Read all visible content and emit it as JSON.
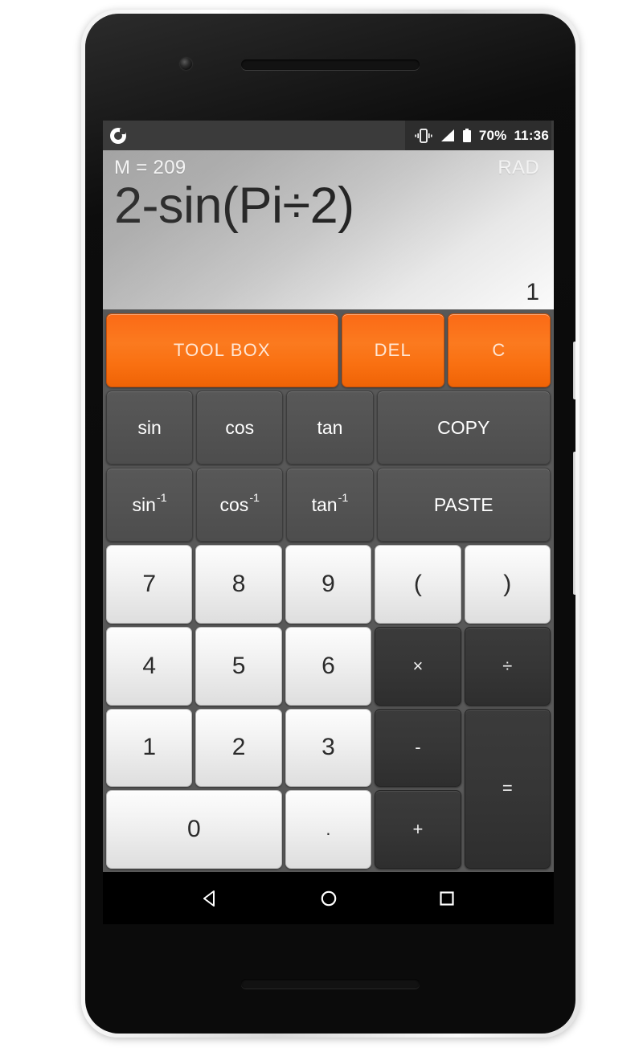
{
  "device": {
    "name": "android-phone",
    "camera_icon": "front-camera",
    "earpiece_icon": "earpiece-speaker",
    "bottom_speaker_icon": "bottom-speaker",
    "power_button": "power-button",
    "volume_button": "volume-rocker"
  },
  "status_bar": {
    "notification_icon": "app-notification-icon",
    "vibrate_icon": "vibrate-icon",
    "signal_icon": "signal-bars-icon",
    "battery_icon": "battery-icon",
    "battery_percent": "70%",
    "clock": "11:36",
    "background_color": "#3b3b3b"
  },
  "display": {
    "memory_label": "M = 209",
    "angle_mode": "RAD",
    "expression": "2-sin(Pi÷2)",
    "result": "1"
  },
  "keypad": {
    "accent_color": "#fb7a1f",
    "row_orange": [
      {
        "label": "TOOL BOX",
        "name": "tool-box-button",
        "span": "f3"
      },
      {
        "label": "DEL",
        "name": "del-button",
        "span": "f13"
      },
      {
        "label": "C",
        "name": "clear-button",
        "span": "f13"
      }
    ],
    "row_trig": [
      {
        "label": "sin",
        "name": "sin-button",
        "span": "f1"
      },
      {
        "label": "cos",
        "name": "cos-button",
        "span": "f1"
      },
      {
        "label": "tan",
        "name": "tan-button",
        "span": "f1"
      },
      {
        "label": "COPY",
        "name": "copy-button",
        "span": "f2"
      }
    ],
    "row_inverse": [
      {
        "base": "sin",
        "sup": "-1",
        "name": "arcsin-button",
        "span": "f1"
      },
      {
        "base": "cos",
        "sup": "-1",
        "name": "arccos-button",
        "span": "f1"
      },
      {
        "base": "tan",
        "sup": "-1",
        "name": "arctan-button",
        "span": "f1"
      },
      {
        "label": "PASTE",
        "name": "paste-button",
        "span": "f2"
      }
    ],
    "digits": {
      "seven": "7",
      "eight": "8",
      "nine": "9",
      "four": "4",
      "five": "5",
      "six": "6",
      "one": "1",
      "two": "2",
      "three": "3",
      "zero": "0",
      "decimal": "."
    },
    "operators": {
      "paren_open": "(",
      "paren_close": ")",
      "multiply": "×",
      "divide": "÷",
      "subtract": "-",
      "add": "+",
      "equals": "="
    }
  },
  "navbar": {
    "back": "back-icon",
    "home": "home-icon",
    "recents": "recents-icon"
  }
}
